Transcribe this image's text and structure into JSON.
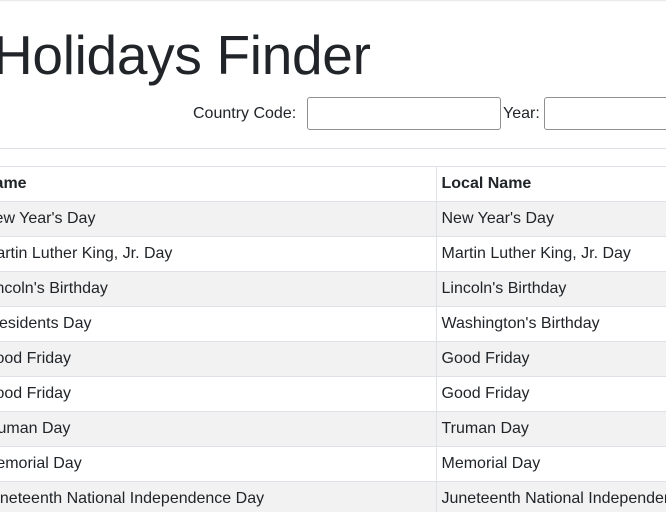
{
  "app": {
    "title": "Holidays Finder"
  },
  "search": {
    "country_label": "Country Code:",
    "country_value": "",
    "year_label": "Year:",
    "year_value": ""
  },
  "table": {
    "columns": [
      "Name",
      "Local Name"
    ],
    "rows": [
      [
        "New Year's Day",
        "New Year's Day"
      ],
      [
        "Martin Luther King, Jr. Day",
        "Martin Luther King, Jr. Day"
      ],
      [
        "Lincoln's Birthday",
        "Lincoln's Birthday"
      ],
      [
        "Presidents Day",
        "Washington's Birthday"
      ],
      [
        "Good Friday",
        "Good Friday"
      ],
      [
        "Good Friday",
        "Good Friday"
      ],
      [
        "Truman Day",
        "Truman Day"
      ],
      [
        "Memorial Day",
        "Memorial Day"
      ],
      [
        "Juneteenth National Independence Day",
        "Juneteenth National Independence Day"
      ]
    ]
  }
}
